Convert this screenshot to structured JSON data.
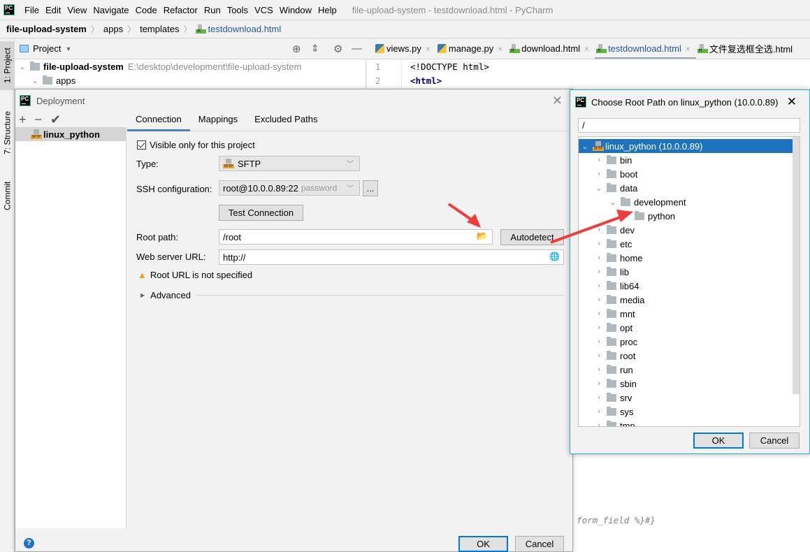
{
  "app": {
    "menu": [
      "File",
      "Edit",
      "View",
      "Navigate",
      "Code",
      "Refactor",
      "Run",
      "Tools",
      "VCS",
      "Window",
      "Help"
    ],
    "window_title": "file-upload-system - testdownload.html - PyCharm"
  },
  "breadcrumb": [
    "file-upload-system",
    "apps",
    "templates",
    "testdownload.html"
  ],
  "toolstrip": {
    "tabs": [
      "1: Project",
      "7: Structure",
      "Commit"
    ]
  },
  "project_panel": {
    "title": "Project",
    "root_name": "file-upload-system",
    "root_path": "E:\\desktop\\development\\file-upload-system",
    "child": "apps"
  },
  "editor": {
    "tabs": [
      {
        "label": "views.py",
        "icon": "python-file-icon",
        "active": false
      },
      {
        "label": "manage.py",
        "icon": "python-file-icon",
        "active": false
      },
      {
        "label": "download.html",
        "icon": "html-file-icon",
        "active": false
      },
      {
        "label": "testdownload.html",
        "icon": "html-file-icon",
        "active": true
      },
      {
        "label": "文件复选框全选.html",
        "icon": "html-file-icon",
        "active": false
      }
    ],
    "lines": [
      {
        "num": "1",
        "text": "<!DOCTYPE html>"
      },
      {
        "num": "2",
        "text": "<html>"
      }
    ],
    "visible_fragment": "t form_field %}#}"
  },
  "deployment": {
    "title": "Deployment",
    "server": "linux_python",
    "tabs": [
      "Connection",
      "Mappings",
      "Excluded Paths"
    ],
    "visible_only_label": "Visible only for this project",
    "visible_only_checked": true,
    "type_label": "Type:",
    "type_value": "SFTP",
    "ssh_label": "SSH configuration:",
    "ssh_value": "root@10.0.0.89:22",
    "ssh_auth": "password",
    "ssh_more": "...",
    "test_connection": "Test Connection",
    "root_path_label": "Root path:",
    "root_path_value": "/root",
    "autodetect": "Autodetect",
    "web_url_label": "Web server URL:",
    "web_url_value": "http://",
    "warning": "Root URL is not specified",
    "advanced": "Advanced",
    "ok": "OK",
    "cancel": "Cancel",
    "help": "?"
  },
  "chooser": {
    "title": "Choose Root Path on linux_python (10.0.0.89)",
    "path_value": "/",
    "root_node": "linux_python (10.0.0.89)",
    "nodes": [
      {
        "name": "bin",
        "depth": 1,
        "state": "collapsed"
      },
      {
        "name": "boot",
        "depth": 1,
        "state": "collapsed"
      },
      {
        "name": "data",
        "depth": 1,
        "state": "expanded"
      },
      {
        "name": "development",
        "depth": 2,
        "state": "expanded"
      },
      {
        "name": "python",
        "depth": 3,
        "state": "leaf"
      },
      {
        "name": "dev",
        "depth": 1,
        "state": "collapsed"
      },
      {
        "name": "etc",
        "depth": 1,
        "state": "collapsed"
      },
      {
        "name": "home",
        "depth": 1,
        "state": "collapsed"
      },
      {
        "name": "lib",
        "depth": 1,
        "state": "collapsed"
      },
      {
        "name": "lib64",
        "depth": 1,
        "state": "collapsed"
      },
      {
        "name": "media",
        "depth": 1,
        "state": "collapsed"
      },
      {
        "name": "mnt",
        "depth": 1,
        "state": "collapsed"
      },
      {
        "name": "opt",
        "depth": 1,
        "state": "collapsed"
      },
      {
        "name": "proc",
        "depth": 1,
        "state": "collapsed"
      },
      {
        "name": "root",
        "depth": 1,
        "state": "collapsed"
      },
      {
        "name": "run",
        "depth": 1,
        "state": "collapsed"
      },
      {
        "name": "sbin",
        "depth": 1,
        "state": "collapsed"
      },
      {
        "name": "srv",
        "depth": 1,
        "state": "collapsed"
      },
      {
        "name": "sys",
        "depth": 1,
        "state": "collapsed"
      },
      {
        "name": "tmp",
        "depth": 1,
        "state": "collapsed"
      }
    ],
    "ok": "OK",
    "cancel": "Cancel"
  },
  "colors": {
    "selection": "#1e73be",
    "accent_tab": "#4083c9",
    "annotation_arrow": "#f03c3c",
    "warning": "#f2a20c"
  }
}
